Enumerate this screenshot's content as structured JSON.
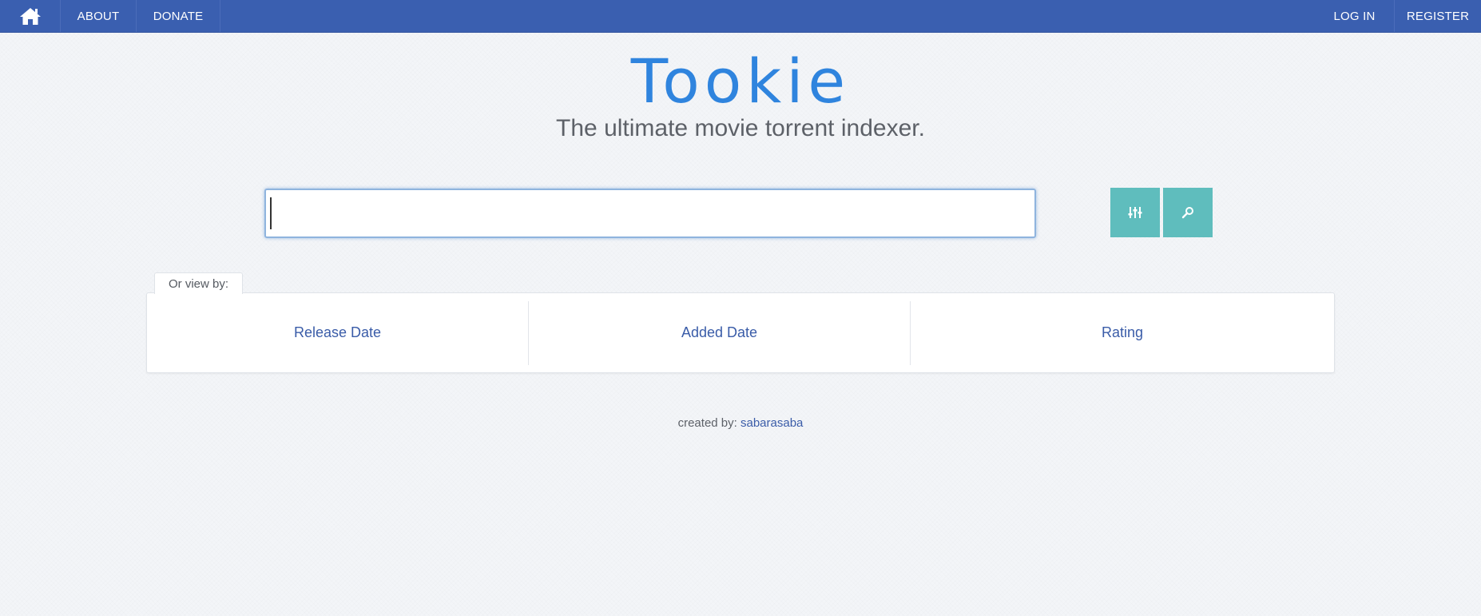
{
  "nav": {
    "home_icon": "home-icon",
    "left_items": [
      {
        "label": "ABOUT"
      },
      {
        "label": "DONATE"
      }
    ],
    "right_items": [
      {
        "label": "LOG IN"
      },
      {
        "label": "REGISTER"
      }
    ],
    "background_color": "#3a5fb0"
  },
  "hero": {
    "title": "Tookie",
    "tagline": "The ultimate movie torrent indexer.",
    "title_color": "#2f84de"
  },
  "search": {
    "value": "",
    "placeholder": "",
    "filters_icon": "sliders-icon",
    "search_icon": "search-icon",
    "button_color": "#5fbdbd"
  },
  "view_by": {
    "tab_label": "Or view by:",
    "options": [
      {
        "label": "Release Date"
      },
      {
        "label": "Added Date"
      },
      {
        "label": "Rating"
      }
    ],
    "link_color": "#3a5ca8"
  },
  "footer": {
    "prefix": "created by:",
    "author": "sabarasaba"
  }
}
